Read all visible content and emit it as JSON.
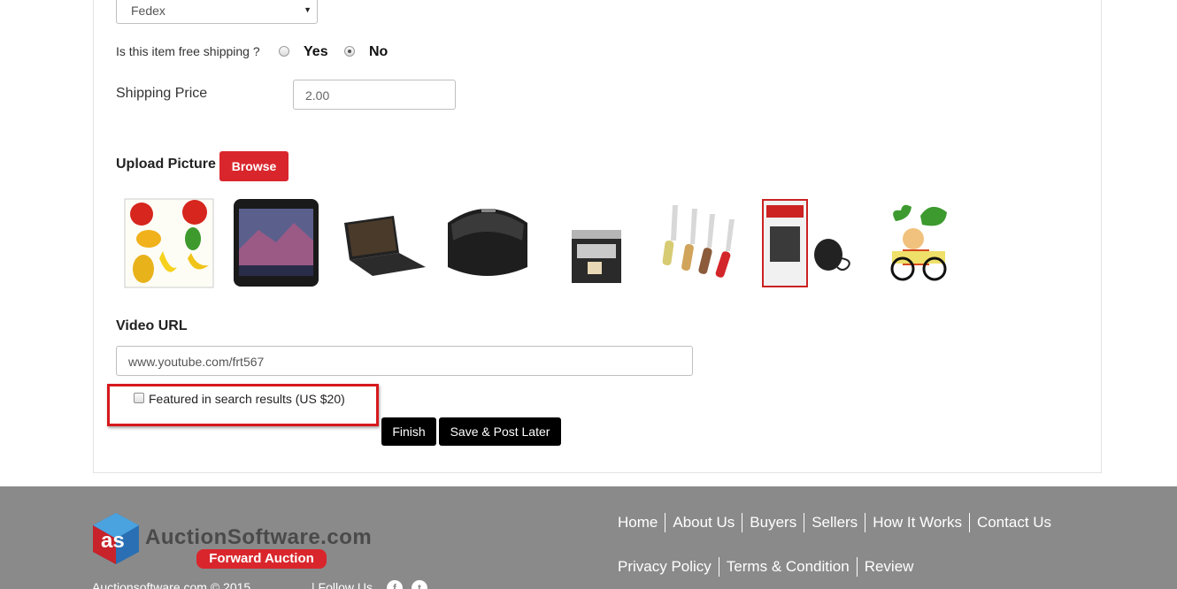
{
  "form": {
    "carrier_select": {
      "value": "Fedex"
    },
    "free_shipping": {
      "label": "Is this item free shipping ?",
      "options": [
        {
          "label": "Yes",
          "checked": false
        },
        {
          "label": "No",
          "checked": true
        }
      ]
    },
    "shipping_price": {
      "label": "Shipping Price",
      "value": "2.00"
    },
    "upload": {
      "label": "Upload Picture",
      "browse_label": "Browse",
      "thumbnails": [
        "fruit-chart",
        "smartphone",
        "laptop",
        "sandwich-maker",
        "espresso-machine",
        "knife-set",
        "appliance-box",
        "kela-wallah-logo"
      ]
    },
    "video": {
      "label": "Video URL",
      "value": "www.youtube.com/frt567"
    },
    "featured": {
      "label": "Featured in search results (US $20)",
      "checked": false
    },
    "finish_label": "Finish",
    "save_later_label": "Save & Post Later"
  },
  "footer": {
    "brand_name": "AuctionSoftware.com",
    "brand_tagline": "Forward Auction",
    "copyright": "Auctionsoftware.com © 2015",
    "follow_label": "| Follow Us",
    "social_icons": [
      "facebook-icon",
      "twitter-icon"
    ],
    "nav_row_1": [
      "Home",
      "About Us",
      "Buyers",
      "Sellers",
      "How It Works",
      "Contact Us"
    ],
    "nav_row_2": [
      "Privacy Policy",
      "Terms & Condition",
      "Review"
    ]
  },
  "colors": {
    "accent_red": "#d9262c",
    "footer_gray": "#8a8a8a",
    "button_black": "#000000"
  }
}
